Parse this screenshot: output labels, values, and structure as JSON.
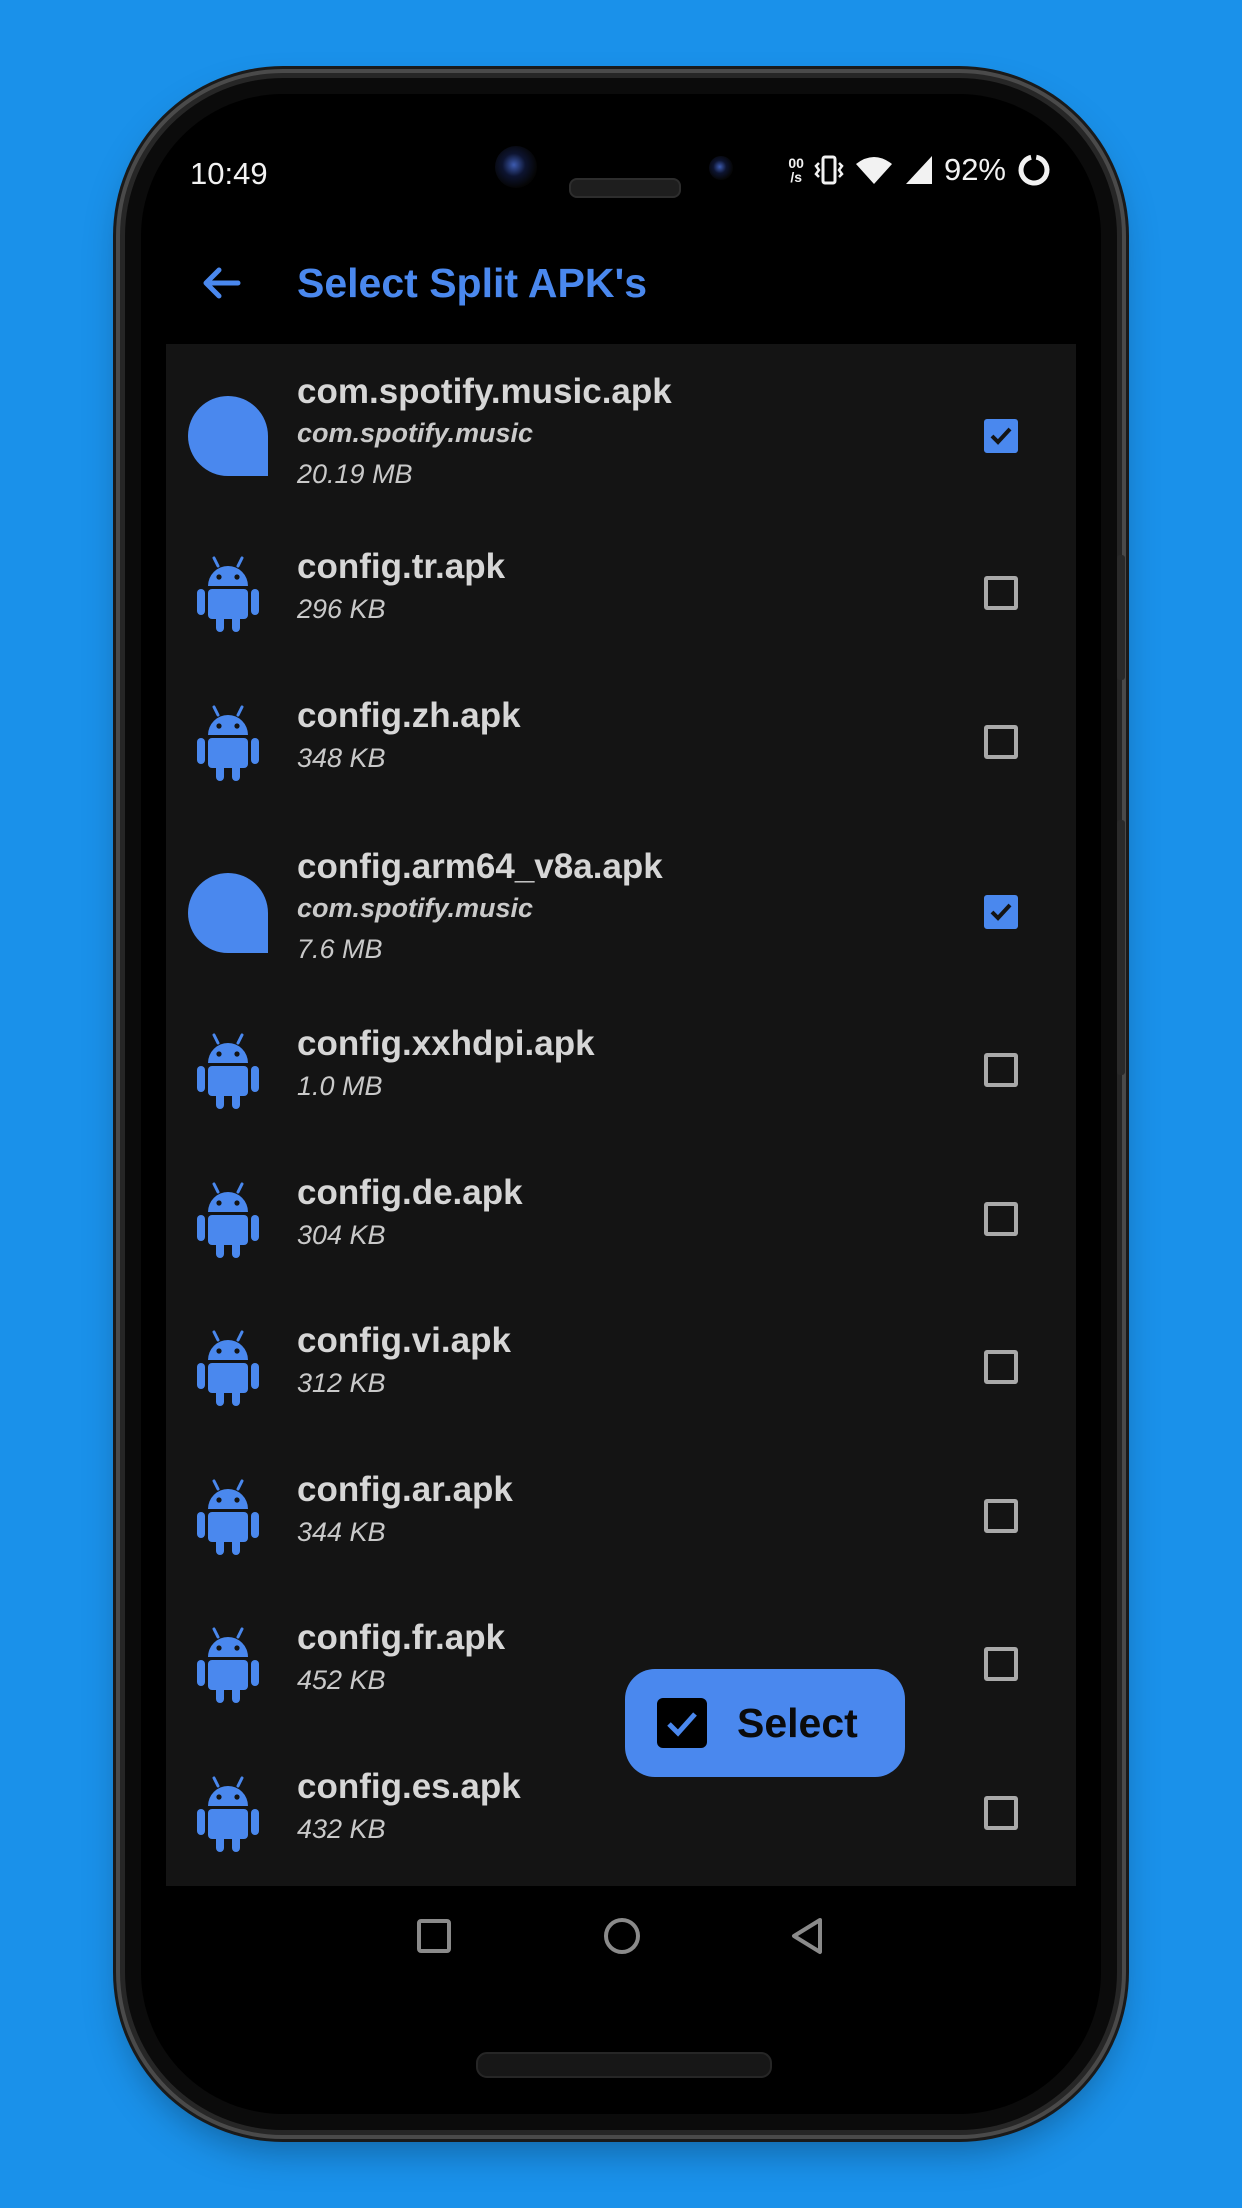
{
  "status_bar": {
    "time": "10:49",
    "battery_percent": "92%",
    "icons": [
      "data-speed-icon",
      "vibrate-icon",
      "wifi-icon",
      "signal-icon",
      "battery-ring-icon"
    ]
  },
  "app_bar": {
    "back_icon": "arrow-back-icon",
    "title": "Select Split APK's"
  },
  "colors": {
    "accent": "#4a88ee",
    "list_background": "#141414",
    "page_background": "#1a91ea"
  },
  "items": [
    {
      "name": "com.spotify.music.apk",
      "package": "com.spotify.music",
      "size": "20.19 MB",
      "icon": "spotify-app-icon",
      "checked": true
    },
    {
      "name": "config.tr.apk",
      "size": "296 KB",
      "icon": "android-icon",
      "checked": false
    },
    {
      "name": "config.zh.apk",
      "size": "348 KB",
      "icon": "android-icon",
      "checked": false
    },
    {
      "name": "config.arm64_v8a.apk",
      "package": "com.spotify.music",
      "size": "7.6 MB",
      "icon": "spotify-app-icon",
      "checked": true
    },
    {
      "name": "config.xxhdpi.apk",
      "size": "1.0 MB",
      "icon": "android-icon",
      "checked": false
    },
    {
      "name": "config.de.apk",
      "size": "304 KB",
      "icon": "android-icon",
      "checked": false
    },
    {
      "name": "config.vi.apk",
      "size": "312 KB",
      "icon": "android-icon",
      "checked": false
    },
    {
      "name": "config.ar.apk",
      "size": "344 KB",
      "icon": "android-icon",
      "checked": false
    },
    {
      "name": "config.fr.apk",
      "size": "452 KB",
      "icon": "android-icon",
      "checked": false
    },
    {
      "name": "config.es.apk",
      "size": "432 KB",
      "icon": "android-icon",
      "checked": false
    }
  ],
  "fab": {
    "label": "Select",
    "icon": "checkbox-checked-icon"
  },
  "nav_bar": {
    "recents_icon": "recents-square-icon",
    "home_icon": "home-circle-icon",
    "back_icon": "back-triangle-icon"
  }
}
